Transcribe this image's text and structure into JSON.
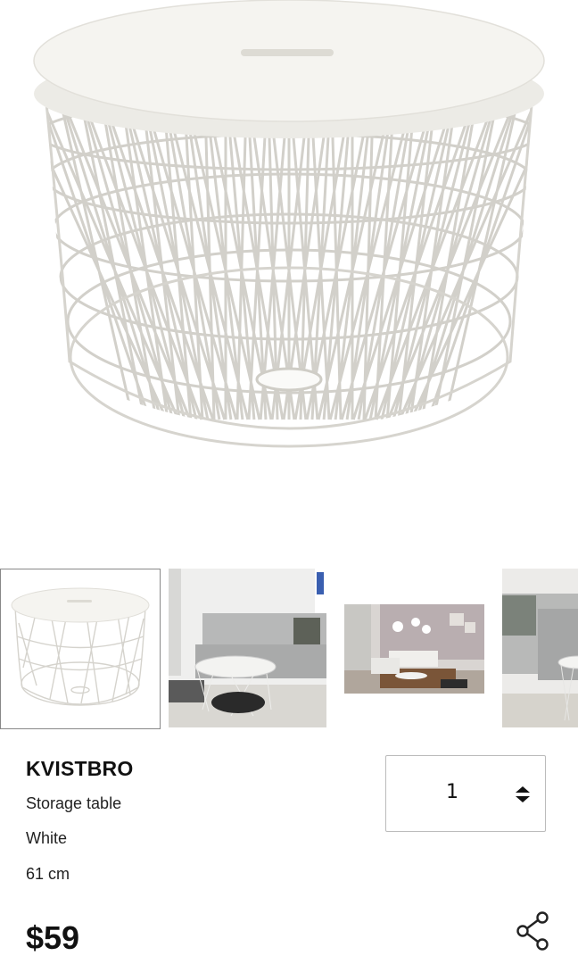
{
  "product": {
    "name": "KVISTBRO",
    "type": "Storage table",
    "color": "White",
    "size": "61 cm",
    "price": "$59"
  },
  "quantity": {
    "value": "1"
  },
  "gallery": {
    "selected_index": 0,
    "thumbnails": [
      {
        "name": "product-front"
      },
      {
        "name": "sofa-room"
      },
      {
        "name": "living-room-wide"
      },
      {
        "name": "sofa-closeup"
      }
    ]
  },
  "colors": {
    "text": "#111111",
    "thumb_border": "#888888",
    "input_border": "#bbbbbb",
    "wire": "#cfcfcf",
    "tabletop": "#f3f2ee"
  }
}
